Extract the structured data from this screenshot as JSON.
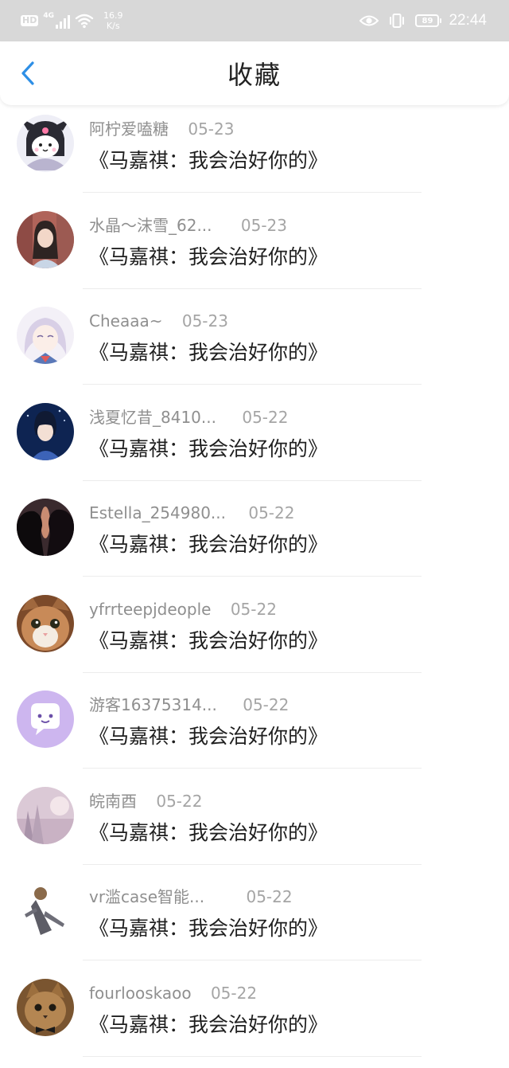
{
  "status_bar": {
    "hd": "HD",
    "network": "4G",
    "speed_value": "16.9",
    "speed_unit": "K/s",
    "battery": "89",
    "time": "22:44",
    "icons": [
      "signal-icon",
      "wifi-icon",
      "eye-icon",
      "vibrate-icon",
      "battery-icon"
    ]
  },
  "header": {
    "title": "收藏",
    "back_icon": "chevron-left-icon",
    "accent_color": "#2e8fe6"
  },
  "favorites": [
    {
      "user": "阿柠爱嗑糖",
      "date": "05-23",
      "title": "《马嘉祺：我会治好你的》"
    },
    {
      "user": "水晶～沫雪_62...",
      "date": "05-23",
      "title": "《马嘉祺：我会治好你的》"
    },
    {
      "user": "Cheaaa~",
      "date": "05-23",
      "title": "《马嘉祺：我会治好你的》"
    },
    {
      "user": "浅夏忆昔_8410...",
      "date": "05-22",
      "title": "《马嘉祺：我会治好你的》"
    },
    {
      "user": "Estella_254980...",
      "date": "05-22",
      "title": "《马嘉祺：我会治好你的》"
    },
    {
      "user": "yfrrteepjdeople",
      "date": "05-22",
      "title": "《马嘉祺：我会治好你的》"
    },
    {
      "user": "游客16375314...",
      "date": "05-22",
      "title": "《马嘉祺：我会治好你的》"
    },
    {
      "user": "皖南酉",
      "date": "05-22",
      "title": "《马嘉祺：我会治好你的》"
    },
    {
      "user": "vr滥case智能...",
      "date": "05-22",
      "title": "《马嘉祺：我会治好你的》"
    },
    {
      "user": "fourlooskaoo",
      "date": "05-22",
      "title": "《马嘉祺：我会治好你的》"
    }
  ]
}
